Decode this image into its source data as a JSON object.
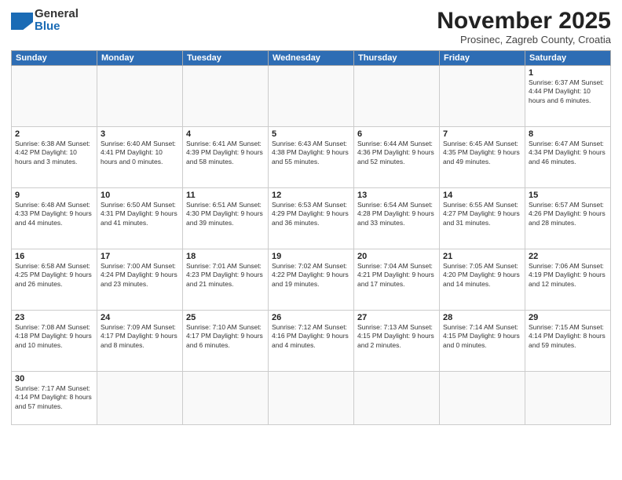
{
  "header": {
    "logo": "General Blue",
    "month": "November 2025",
    "location": "Prosinec, Zagreb County, Croatia"
  },
  "weekdays": [
    "Sunday",
    "Monday",
    "Tuesday",
    "Wednesday",
    "Thursday",
    "Friday",
    "Saturday"
  ],
  "weeks": [
    [
      {
        "day": "",
        "info": ""
      },
      {
        "day": "",
        "info": ""
      },
      {
        "day": "",
        "info": ""
      },
      {
        "day": "",
        "info": ""
      },
      {
        "day": "",
        "info": ""
      },
      {
        "day": "",
        "info": ""
      },
      {
        "day": "1",
        "info": "Sunrise: 6:37 AM\nSunset: 4:44 PM\nDaylight: 10 hours and 6 minutes."
      }
    ],
    [
      {
        "day": "2",
        "info": "Sunrise: 6:38 AM\nSunset: 4:42 PM\nDaylight: 10 hours and 3 minutes."
      },
      {
        "day": "3",
        "info": "Sunrise: 6:40 AM\nSunset: 4:41 PM\nDaylight: 10 hours and 0 minutes."
      },
      {
        "day": "4",
        "info": "Sunrise: 6:41 AM\nSunset: 4:39 PM\nDaylight: 9 hours and 58 minutes."
      },
      {
        "day": "5",
        "info": "Sunrise: 6:43 AM\nSunset: 4:38 PM\nDaylight: 9 hours and 55 minutes."
      },
      {
        "day": "6",
        "info": "Sunrise: 6:44 AM\nSunset: 4:36 PM\nDaylight: 9 hours and 52 minutes."
      },
      {
        "day": "7",
        "info": "Sunrise: 6:45 AM\nSunset: 4:35 PM\nDaylight: 9 hours and 49 minutes."
      },
      {
        "day": "8",
        "info": "Sunrise: 6:47 AM\nSunset: 4:34 PM\nDaylight: 9 hours and 46 minutes."
      }
    ],
    [
      {
        "day": "9",
        "info": "Sunrise: 6:48 AM\nSunset: 4:33 PM\nDaylight: 9 hours and 44 minutes."
      },
      {
        "day": "10",
        "info": "Sunrise: 6:50 AM\nSunset: 4:31 PM\nDaylight: 9 hours and 41 minutes."
      },
      {
        "day": "11",
        "info": "Sunrise: 6:51 AM\nSunset: 4:30 PM\nDaylight: 9 hours and 39 minutes."
      },
      {
        "day": "12",
        "info": "Sunrise: 6:53 AM\nSunset: 4:29 PM\nDaylight: 9 hours and 36 minutes."
      },
      {
        "day": "13",
        "info": "Sunrise: 6:54 AM\nSunset: 4:28 PM\nDaylight: 9 hours and 33 minutes."
      },
      {
        "day": "14",
        "info": "Sunrise: 6:55 AM\nSunset: 4:27 PM\nDaylight: 9 hours and 31 minutes."
      },
      {
        "day": "15",
        "info": "Sunrise: 6:57 AM\nSunset: 4:26 PM\nDaylight: 9 hours and 28 minutes."
      }
    ],
    [
      {
        "day": "16",
        "info": "Sunrise: 6:58 AM\nSunset: 4:25 PM\nDaylight: 9 hours and 26 minutes."
      },
      {
        "day": "17",
        "info": "Sunrise: 7:00 AM\nSunset: 4:24 PM\nDaylight: 9 hours and 23 minutes."
      },
      {
        "day": "18",
        "info": "Sunrise: 7:01 AM\nSunset: 4:23 PM\nDaylight: 9 hours and 21 minutes."
      },
      {
        "day": "19",
        "info": "Sunrise: 7:02 AM\nSunset: 4:22 PM\nDaylight: 9 hours and 19 minutes."
      },
      {
        "day": "20",
        "info": "Sunrise: 7:04 AM\nSunset: 4:21 PM\nDaylight: 9 hours and 17 minutes."
      },
      {
        "day": "21",
        "info": "Sunrise: 7:05 AM\nSunset: 4:20 PM\nDaylight: 9 hours and 14 minutes."
      },
      {
        "day": "22",
        "info": "Sunrise: 7:06 AM\nSunset: 4:19 PM\nDaylight: 9 hours and 12 minutes."
      }
    ],
    [
      {
        "day": "23",
        "info": "Sunrise: 7:08 AM\nSunset: 4:18 PM\nDaylight: 9 hours and 10 minutes."
      },
      {
        "day": "24",
        "info": "Sunrise: 7:09 AM\nSunset: 4:17 PM\nDaylight: 9 hours and 8 minutes."
      },
      {
        "day": "25",
        "info": "Sunrise: 7:10 AM\nSunset: 4:17 PM\nDaylight: 9 hours and 6 minutes."
      },
      {
        "day": "26",
        "info": "Sunrise: 7:12 AM\nSunset: 4:16 PM\nDaylight: 9 hours and 4 minutes."
      },
      {
        "day": "27",
        "info": "Sunrise: 7:13 AM\nSunset: 4:15 PM\nDaylight: 9 hours and 2 minutes."
      },
      {
        "day": "28",
        "info": "Sunrise: 7:14 AM\nSunset: 4:15 PM\nDaylight: 9 hours and 0 minutes."
      },
      {
        "day": "29",
        "info": "Sunrise: 7:15 AM\nSunset: 4:14 PM\nDaylight: 8 hours and 59 minutes."
      }
    ],
    [
      {
        "day": "30",
        "info": "Sunrise: 7:17 AM\nSunset: 4:14 PM\nDaylight: 8 hours and 57 minutes."
      },
      {
        "day": "",
        "info": ""
      },
      {
        "day": "",
        "info": ""
      },
      {
        "day": "",
        "info": ""
      },
      {
        "day": "",
        "info": ""
      },
      {
        "day": "",
        "info": ""
      },
      {
        "day": "",
        "info": ""
      }
    ]
  ]
}
